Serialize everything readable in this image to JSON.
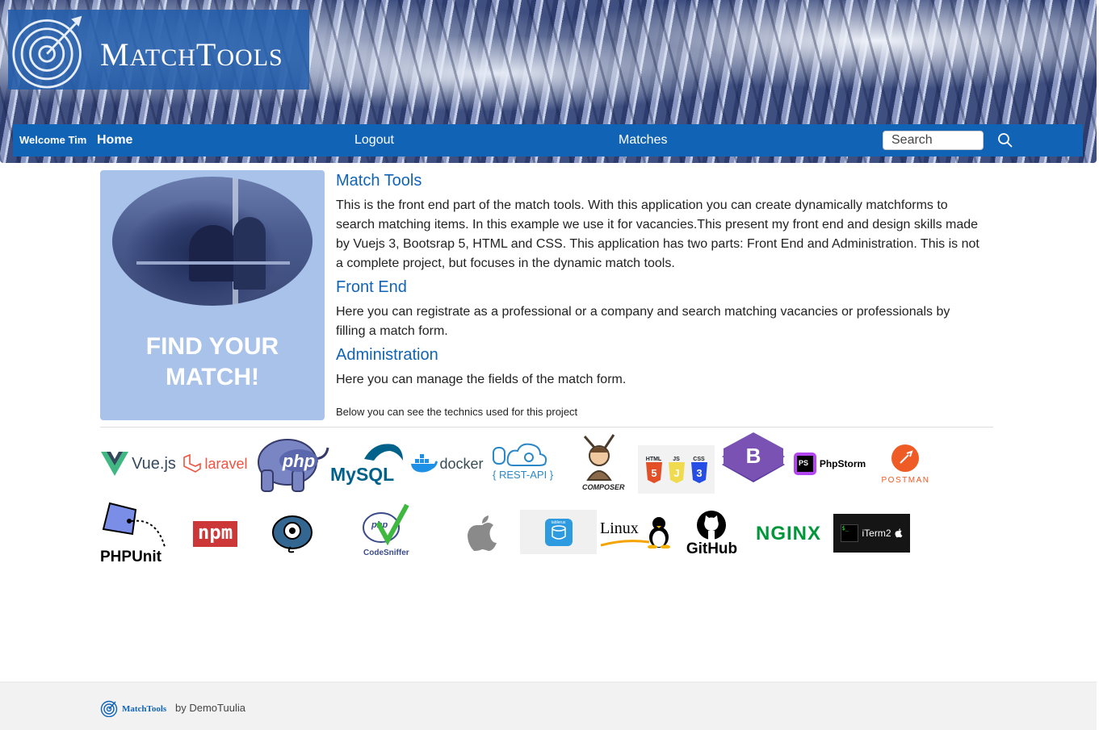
{
  "header": {
    "logo_big_m": "M",
    "logo_rest_1": "ATCH",
    "logo_big_t": "T",
    "logo_rest_2": "OOLS"
  },
  "nav": {
    "welcome": "Welcome Tim",
    "home": "Home",
    "logout": "Logout",
    "matches": "Matches",
    "search_placeholder": "Search"
  },
  "side_card": {
    "title_line1": "FIND YOUR",
    "title_line2": "MATCH!"
  },
  "content": {
    "match_tools_title": "Match Tools",
    "match_tools_text": "This is the front end part of the match tools. With this application you can create dynamically matchforms to search matching items. In this example we use it for vacancies.This present my front end and design skills made by Vuejs 3, Bootsrap 5, HTML and CSS. This application has two parts: Front End and Administration. This is not a complete project, but focuses in the dynamic match tools.",
    "front_end_title": "Front End",
    "front_end_text": "Here you can registrate as a professional or a company and search matching vacancies or professionals by filling a match form.",
    "admin_title": "Administration",
    "admin_text": "Here you can manage the fields of the match form.",
    "below_text": "Below you can see the technics used for this project"
  },
  "tech_logos": {
    "vue": "Vue.js",
    "laravel": "laravel",
    "php": "php",
    "mysql": "MySQL",
    "docker": "docker",
    "rest_api": "{ REST-API }",
    "composer": "COMPOSER",
    "html": "HTML",
    "js": "JS",
    "css": "CSS",
    "bootstrap": "B",
    "phpstorm": "PhpStorm",
    "phpstorm_badge": "PS",
    "postman": "POSTMAN",
    "phpunit": "PHPUnit",
    "npm": "npm",
    "codesniffer": "CodeSniffer",
    "codesniffer_php": "php",
    "tablerus": "tablerus",
    "linux": "Linux",
    "github": "GitHub",
    "nginx": "NGINX",
    "iterm": "iTerm2",
    "iterm_prompt": "$_"
  },
  "footer": {
    "logo_text": "MatchTools",
    "by_text": "by DemoTuulia"
  },
  "colors": {
    "primary": "#1164b5",
    "side_card": "#a8c2ea",
    "footer_bg": "#f2f2f2"
  }
}
